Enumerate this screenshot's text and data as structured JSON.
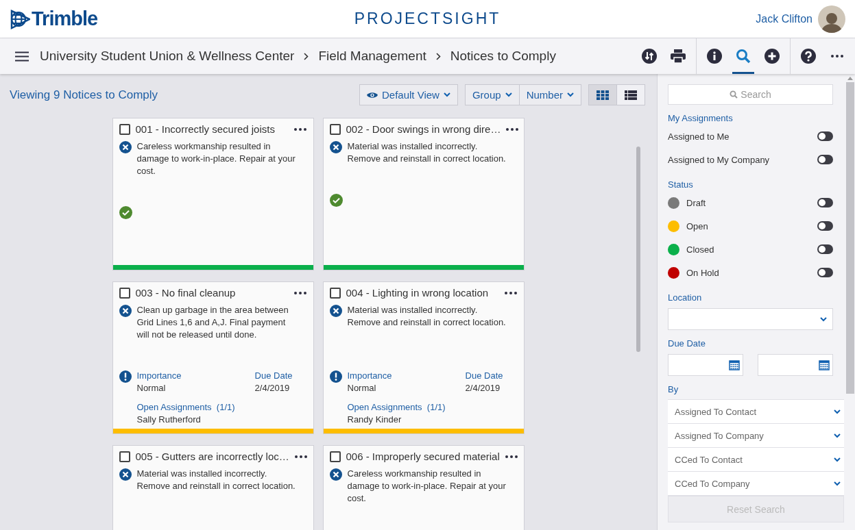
{
  "header": {
    "logo": "Trimble",
    "app_title": "PROJECTSIGHT",
    "user": "Jack Clifton"
  },
  "toolbar": {
    "breadcrumbs": [
      "University Student Union & Wellness Center",
      "Field Management",
      "Notices to Comply"
    ],
    "tools": [
      {
        "kind": "sync",
        "selected": false
      },
      {
        "kind": "print",
        "selected": false
      },
      {
        "kind": "info",
        "selected": false
      },
      {
        "kind": "search",
        "selected": true
      },
      {
        "kind": "add",
        "selected": false
      },
      {
        "kind": "help",
        "selected": false
      },
      {
        "kind": "more",
        "selected": false
      }
    ]
  },
  "list_header": {
    "count_text": "Viewing 9 Notices to Comply",
    "view_button": "Default View",
    "group_button": "Group",
    "sort_button": "Number",
    "layouts": [
      {
        "kind": "grid",
        "selected": true
      },
      {
        "kind": "list",
        "selected": false
      }
    ]
  },
  "cards": [
    {
      "kind": "closed",
      "title": "001 - Incorrectly secured joists",
      "checked": false,
      "description": "Careless workmanship resulted in damage to work-in-place. Repair at your cost.",
      "color": "#0bb04b"
    },
    {
      "kind": "closed",
      "title": "002 - Door swings in wrong dire…",
      "checked": false,
      "description": "Material was installed incorrectly. Remove and reinstall in correct location.",
      "color": "#0bb04b"
    },
    {
      "kind": "open",
      "title": "003 - No final cleanup",
      "checked": false,
      "description": "Clean up garbage in the area between Grid Lines 1,6 and A,J. Final payment will not be released until done.",
      "importance_label": "Importance",
      "importance": "Normal",
      "due_label": "Due Date",
      "due": "2/4/2019",
      "assignments_label": "Open Assignments",
      "assignments_count": "(1/1)",
      "assignee": "Sally Rutherford",
      "color": "#fdbd00"
    },
    {
      "kind": "open",
      "title": "004 - Lighting in wrong location",
      "checked": false,
      "description": "Material was installed incorrectly. Remove and reinstall in correct location.",
      "importance_label": "Importance",
      "importance": "Normal",
      "due_label": "Due Date",
      "due": "2/4/2019",
      "assignments_label": "Open Assignments",
      "assignments_count": "(1/1)",
      "assignee": "Randy Kinder",
      "color": "#fdbd00"
    },
    {
      "kind": "partial",
      "title": "005 - Gutters are incorrectly loc…",
      "checked": false,
      "description": "Material was installed incorrectly. Remove and reinstall in correct location."
    },
    {
      "kind": "partial",
      "title": "006 - Improperly secured material",
      "checked": false,
      "description": "Careless workmanship resulted in damage to work-in-place. Repair at your cost."
    }
  ],
  "filters": {
    "search_placeholder": "Search",
    "my_assignments": {
      "heading": "My Assignments",
      "toggles": [
        {
          "label": "Assigned to Me",
          "on": false
        },
        {
          "label": "Assigned to My Company",
          "on": false
        }
      ]
    },
    "status": {
      "heading": "Status",
      "items": [
        {
          "label": "Draft",
          "color": "#7a7a7a",
          "on": false
        },
        {
          "label": "Open",
          "color": "#fdbd00",
          "on": false
        },
        {
          "label": "Closed",
          "color": "#0bb04b",
          "on": false
        },
        {
          "label": "On Hold",
          "color": "#c00000",
          "on": false
        }
      ]
    },
    "location": {
      "label": "Location"
    },
    "due_date": {
      "label": "Due Date"
    },
    "by": {
      "label": "By",
      "dropdowns": [
        "Assigned To Contact",
        "Assigned To Company",
        "CCed To Contact",
        "CCed To Company"
      ]
    },
    "reset_button": {
      "label": "Reset Search",
      "disabled": true
    }
  }
}
